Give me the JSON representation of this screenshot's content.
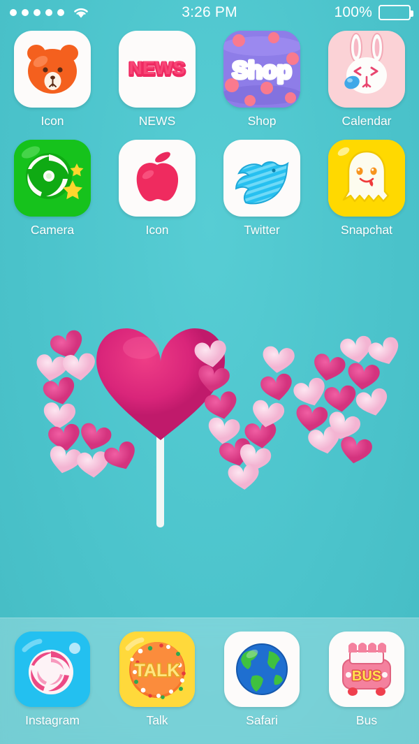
{
  "status_bar": {
    "signal_dots": 5,
    "wifi_icon": "wifi-icon",
    "time": "3:26 PM",
    "battery_percent": "100%",
    "battery_icon": "battery-full-icon"
  },
  "wallpaper": {
    "description": "candy hearts spelling love with heart lollipop",
    "background_color": "#4ec6ce",
    "candy_pink": "#f6b7d4",
    "candy_magenta": "#e0408a"
  },
  "home_screen": {
    "apps": [
      {
        "label": "Icon",
        "icon": "bear-icon",
        "bg": "#fdfbfa"
      },
      {
        "label": "NEWS",
        "icon": "news-icon",
        "bg": "#fdfbfa"
      },
      {
        "label": "Shop",
        "icon": "shop-icon",
        "bg": "#8e7de8"
      },
      {
        "label": "Calendar",
        "icon": "rabbit-icon",
        "bg": "#fbd2d6"
      },
      {
        "label": "Camera",
        "icon": "camera-icon",
        "bg": "#16c21c"
      },
      {
        "label": "Icon",
        "icon": "apple-icon",
        "bg": "#fdfbfa"
      },
      {
        "label": "Twitter",
        "icon": "bird-icon",
        "bg": "#fdfbfa"
      },
      {
        "label": "Snapchat",
        "icon": "ghost-icon",
        "bg": "#ffd900"
      }
    ]
  },
  "dock": {
    "apps": [
      {
        "label": "Instagram",
        "icon": "lollipop-swirl-icon",
        "bg": "#23c0f0"
      },
      {
        "label": "Talk",
        "icon": "talk-cookie-icon",
        "bg": "#ffd93b"
      },
      {
        "label": "Safari",
        "icon": "globe-icon",
        "bg": "#fdfbfa"
      },
      {
        "label": "Bus",
        "icon": "bus-icon",
        "bg": "#fdfbfa"
      }
    ]
  },
  "colors": {
    "background": "#4ec6ce",
    "label_text": "#ffffff",
    "dock_overlay": "rgba(255,255,255,0.26)"
  }
}
